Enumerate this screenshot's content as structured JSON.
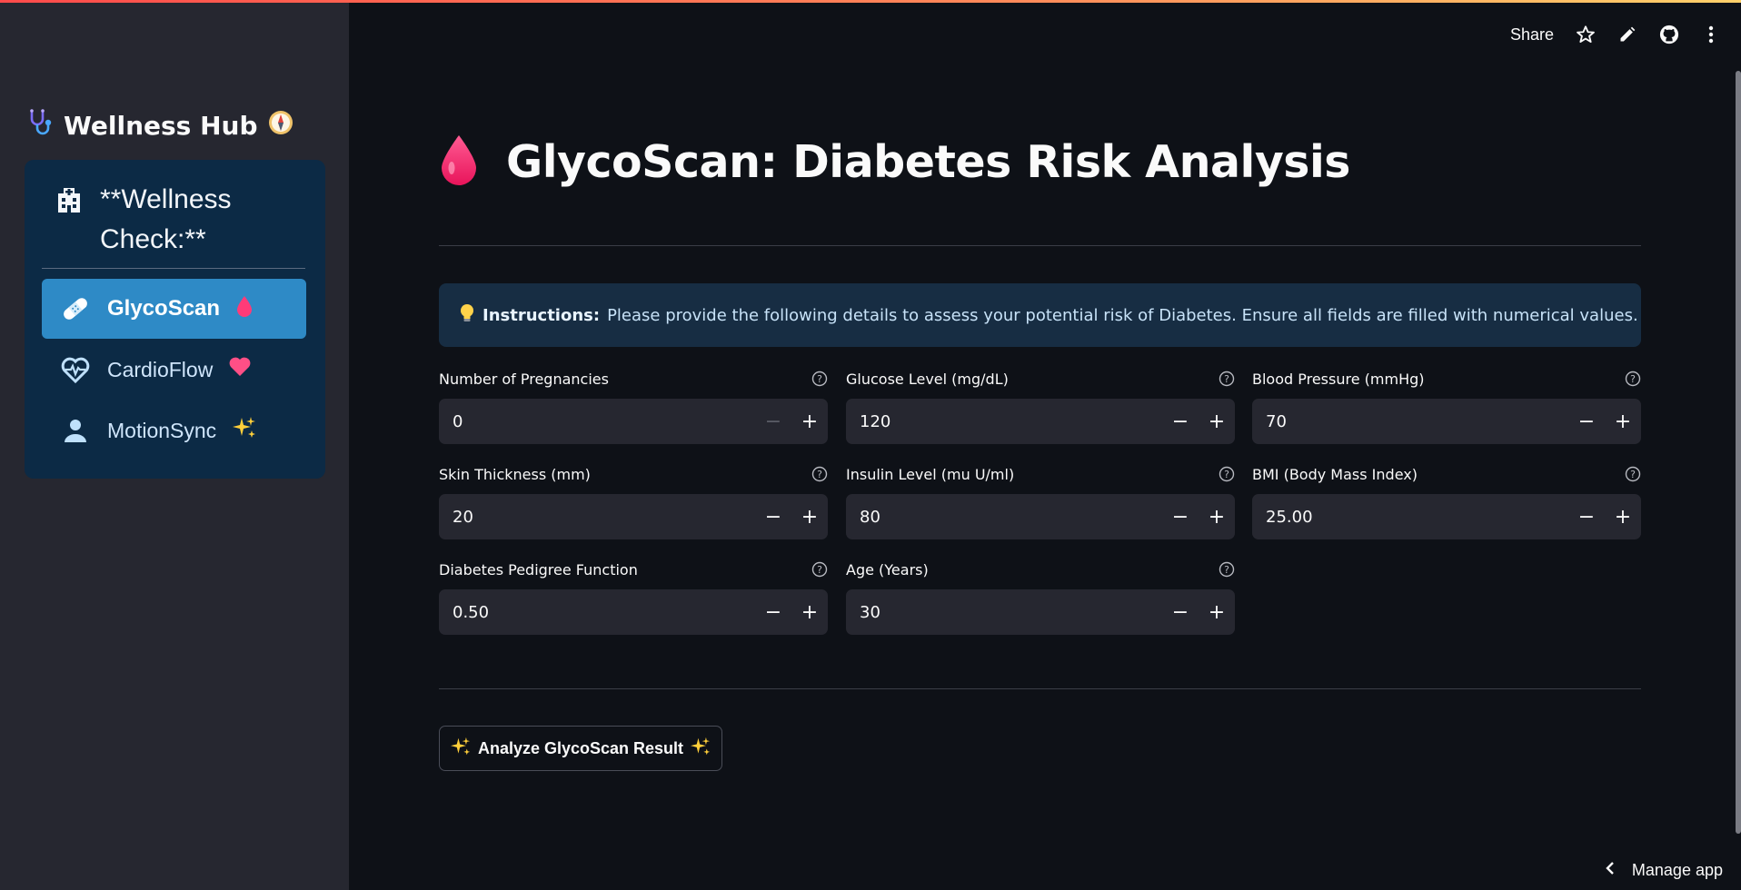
{
  "sidebar": {
    "title": "Wellness Hub",
    "title_icon": "stethoscope-icon",
    "title_trailing_icon": "compass-icon",
    "menu": {
      "header": "**Wellness Check:**",
      "header_icon": "hospital-icon",
      "items": [
        {
          "label": "GlycoScan",
          "icon": "bandage-icon",
          "emoji": "blood-drop-icon",
          "active": true
        },
        {
          "label": "CardioFlow",
          "icon": "heart-pulse-icon",
          "emoji": "heart-icon",
          "active": false
        },
        {
          "label": "MotionSync",
          "icon": "person-icon",
          "emoji": "sparkles-icon",
          "active": false
        }
      ]
    }
  },
  "toolbar": {
    "share_label": "Share",
    "icons": [
      "star-icon",
      "pencil-icon",
      "github-icon",
      "more-vert-icon"
    ]
  },
  "main": {
    "title": "GlycoScan: Diabetes Risk Analysis",
    "title_icon": "blood-drop-icon",
    "instructions": {
      "icon": "lightbulb-icon",
      "bold": "Instructions:",
      "text": "Please provide the following details to assess your potential risk of Diabetes. Ensure all fields are filled with numerical values."
    },
    "fields": [
      {
        "label": "Number of Pregnancies",
        "value": "0"
      },
      {
        "label": "Glucose Level (mg/dL)",
        "value": "120"
      },
      {
        "label": "Blood Pressure (mmHg)",
        "value": "70"
      },
      {
        "label": "Skin Thickness (mm)",
        "value": "20"
      },
      {
        "label": "Insulin Level (mu U/ml)",
        "value": "80"
      },
      {
        "label": "BMI (Body Mass Index)",
        "value": "25.00"
      },
      {
        "label": "Diabetes Pedigree Function",
        "value": "0.50"
      },
      {
        "label": "Age (Years)",
        "value": "30"
      }
    ],
    "stepper": {
      "minus": "−",
      "plus": "+"
    },
    "analyze_button": "Analyze GlycoScan Result",
    "analyze_icon": "sparkles-icon"
  },
  "footer": {
    "manage_app": "Manage app"
  },
  "colors": {
    "background": "#0e1117",
    "sidebar": "#262730",
    "nav_box": "#0c2a45",
    "nav_active": "#2e8ac6",
    "info_box": "#172d43",
    "input_bg": "#262730",
    "accent_drop": "#ff2d6f"
  }
}
